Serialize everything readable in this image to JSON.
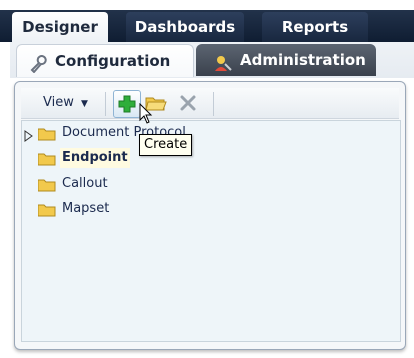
{
  "top_tabs": [
    {
      "label": "Designer"
    },
    {
      "label": "Dashboards"
    },
    {
      "label": "Reports"
    }
  ],
  "sub_tabs": [
    {
      "label": "Configuration",
      "icon": "wrench-icon"
    },
    {
      "label": "Administration",
      "icon": "user-admin-icon"
    }
  ],
  "toolbar": {
    "view_label": "View",
    "create_tooltip": "Create"
  },
  "tree": {
    "items": [
      {
        "label": "Document Protocol",
        "icon": "folder-icon",
        "expandable": true
      },
      {
        "label": "Endpoint",
        "icon": "folder-icon",
        "selected": true
      },
      {
        "label": "Callout",
        "icon": "folder-icon"
      },
      {
        "label": "Mapset",
        "icon": "folder-icon"
      }
    ]
  },
  "colors": {
    "top_bar": "#0f1d32",
    "folder": "#f2c94c",
    "create_icon": "#2fae3a"
  }
}
